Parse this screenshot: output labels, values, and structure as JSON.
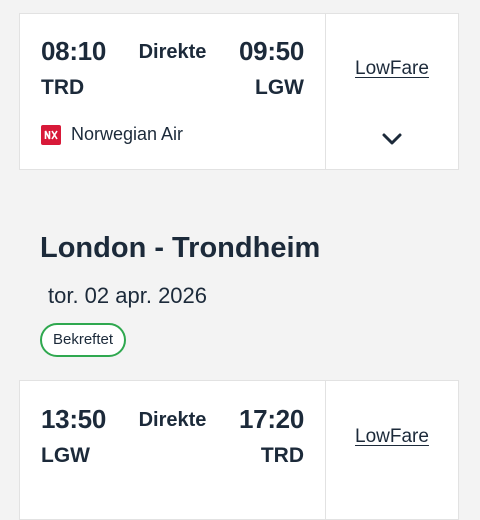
{
  "outbound": {
    "departure_time": "08:10",
    "arrival_time": "09:50",
    "stops_label": "Direkte",
    "departure_code": "TRD",
    "arrival_code": "LGW",
    "airline_name": "Norwegian Air",
    "fare_label": "LowFare",
    "airline_color": "#d81939"
  },
  "return_route": {
    "title": "London - Trondheim",
    "date": "tor. 02 apr. 2026",
    "status": "Bekreftet",
    "status_color": "#2fa84f"
  },
  "inbound": {
    "departure_time": "13:50",
    "arrival_time": "17:20",
    "stops_label": "Direkte",
    "departure_code": "LGW",
    "arrival_code": "TRD",
    "fare_label": "LowFare"
  },
  "icons": {
    "airline_logo": "norwegian-logo-icon",
    "expand": "chevron-down-icon"
  }
}
